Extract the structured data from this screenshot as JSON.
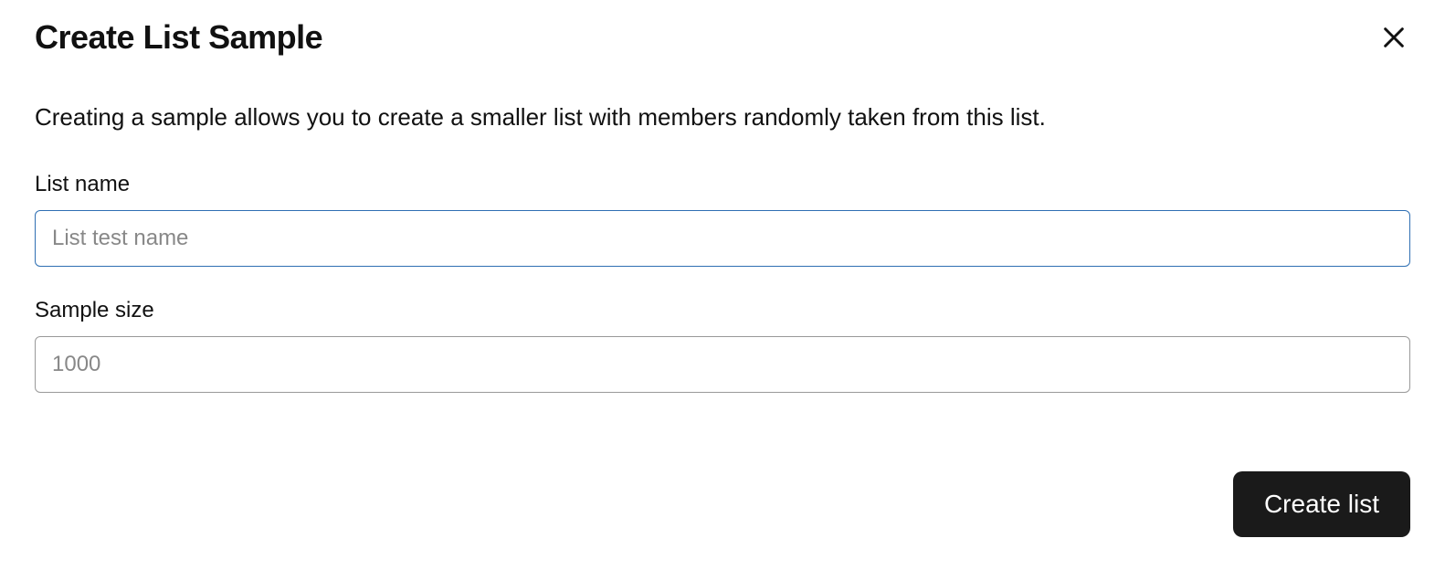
{
  "dialog": {
    "title": "Create List Sample",
    "description": "Creating a sample allows you to create a smaller list with members randomly taken from this list.",
    "fields": {
      "list_name": {
        "label": "List name",
        "placeholder": "List test name",
        "value": ""
      },
      "sample_size": {
        "label": "Sample size",
        "placeholder": "1000",
        "value": ""
      }
    },
    "submit_label": "Create list"
  }
}
